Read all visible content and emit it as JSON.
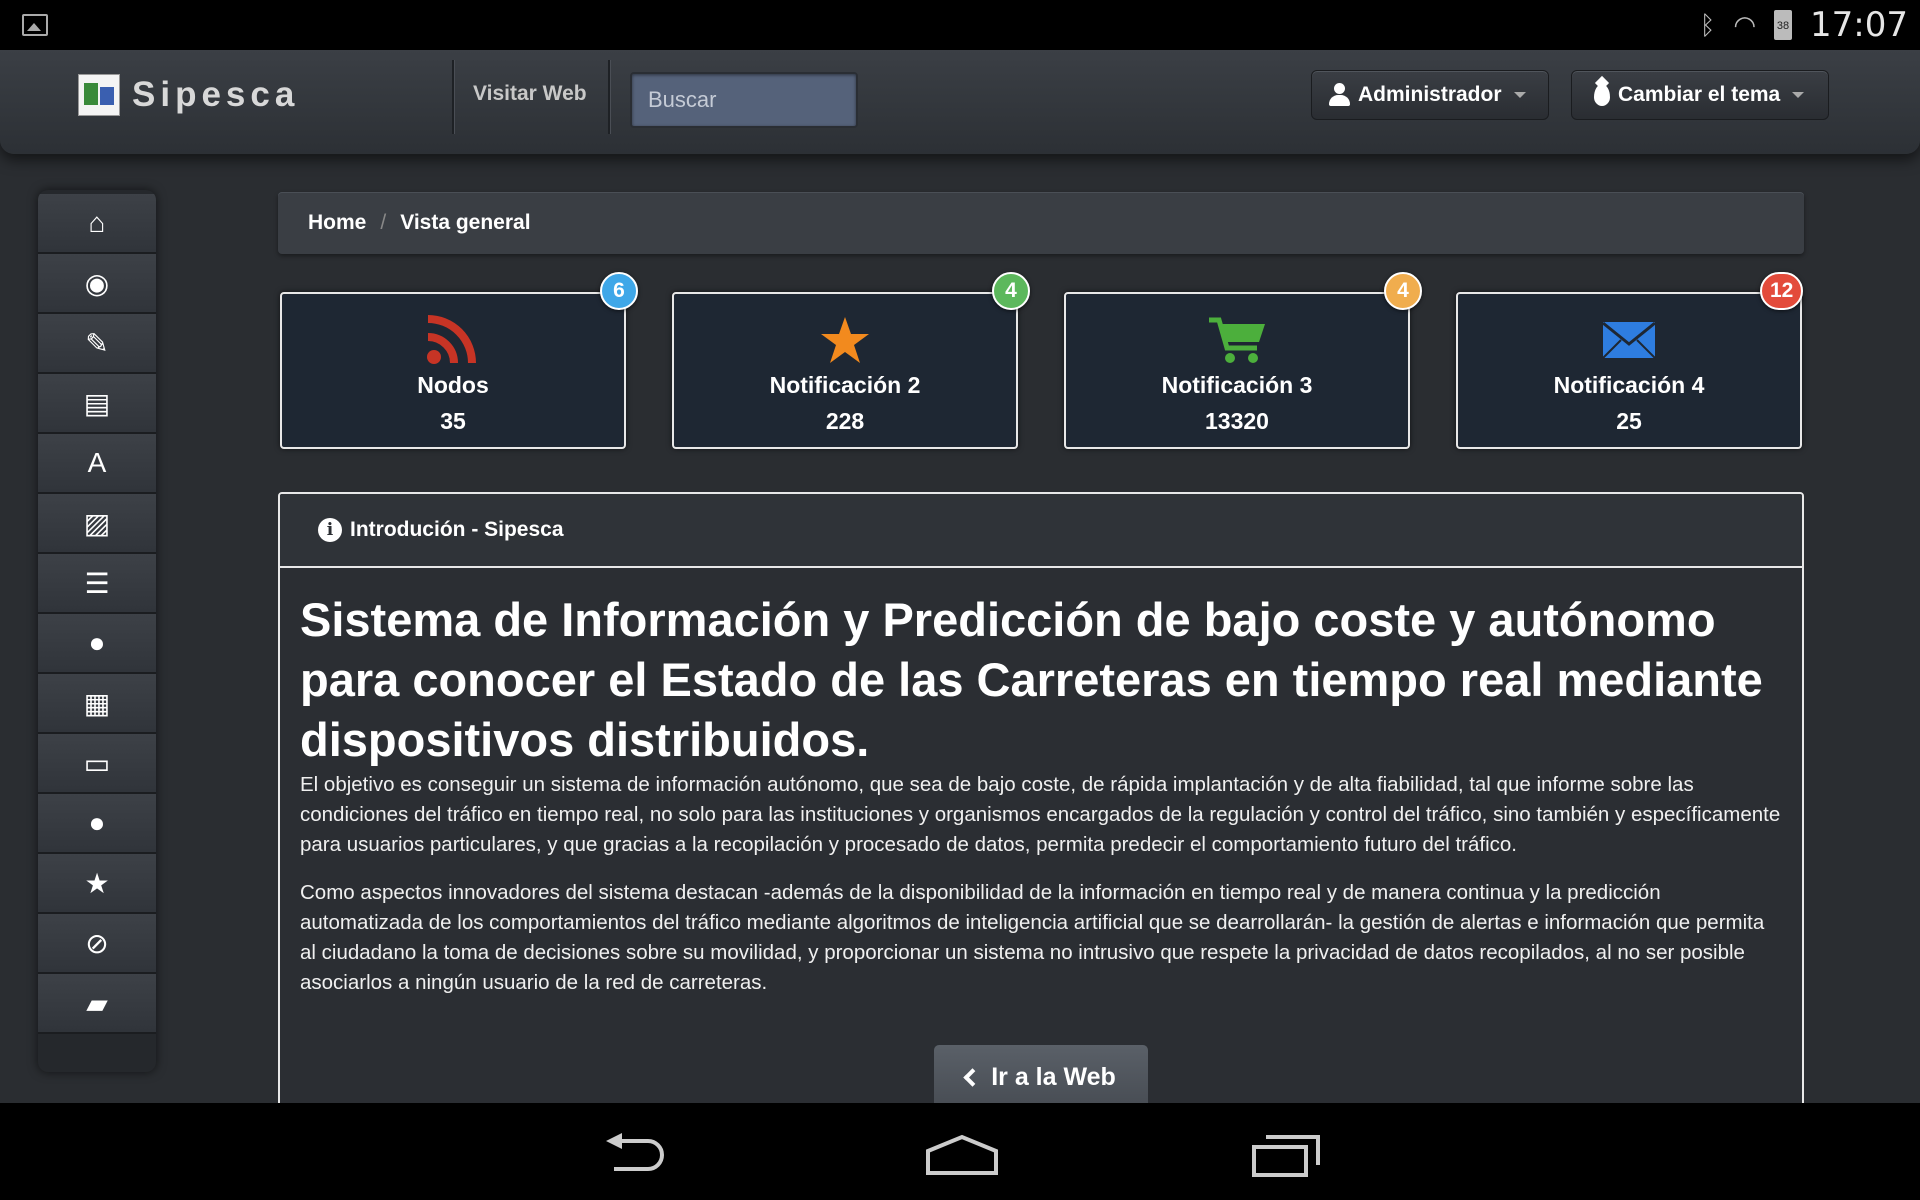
{
  "status_bar": {
    "time": "17:07",
    "battery": "38"
  },
  "navbar": {
    "brand": "Sipesca",
    "visit_web": "Visitar Web",
    "search_placeholder": "Buscar",
    "user_button": "Administrador",
    "theme_button": "Cambiar el tema"
  },
  "sidebar": {
    "items": [
      {
        "icon": "home-icon",
        "glyph": "⌂"
      },
      {
        "icon": "eye-icon",
        "glyph": "◉"
      },
      {
        "icon": "edit-icon",
        "glyph": "✎"
      },
      {
        "icon": "list-alt-icon",
        "glyph": "▤"
      },
      {
        "icon": "font-icon",
        "glyph": "A"
      },
      {
        "icon": "picture-icon",
        "glyph": "▨"
      },
      {
        "icon": "align-justify-icon",
        "glyph": "☰"
      },
      {
        "icon": "globe-icon",
        "glyph": "●"
      },
      {
        "icon": "th-icon",
        "glyph": "▦"
      },
      {
        "icon": "folder-open-icon",
        "glyph": "▭"
      },
      {
        "icon": "globe-icon",
        "glyph": "●"
      },
      {
        "icon": "star-icon",
        "glyph": "★"
      },
      {
        "icon": "ban-icon",
        "glyph": "⊘"
      },
      {
        "icon": "lock-icon",
        "glyph": "▰"
      }
    ]
  },
  "breadcrumb": {
    "home": "Home",
    "separator": "/",
    "current": "Vista general"
  },
  "stats": [
    {
      "icon": "rss-icon",
      "title": "Nodos",
      "value": "35",
      "badge": "6",
      "badge_color": "#3fa7e8"
    },
    {
      "icon": "star-icon",
      "title": "Notificación 2",
      "value": "228",
      "badge": "4",
      "badge_color": "#5cb85c"
    },
    {
      "icon": "shopping-cart-icon",
      "title": "Notificación 3",
      "value": "13320",
      "badge": "4",
      "badge_color": "#f0ad4e"
    },
    {
      "icon": "envelope-icon",
      "title": "Notificación 4",
      "value": "25",
      "badge": "12",
      "badge_color": "#e34b3b"
    }
  ],
  "panel": {
    "header": "Introdución - Sipesca",
    "heading": "Sistema de Información y Predicción de bajo coste y autónomo para conocer el Estado de las Carreteras en tiempo real mediante dispositivos distribuidos.",
    "paragraph1": "El objetivo es conseguir un sistema de información autónomo, que sea de bajo coste, de rápida implantación y de alta fiabilidad, tal que informe sobre las condiciones del tráfico en tiempo real, no solo para las instituciones y organismos encargados de la regulación y control del tráfico, sino también y específicamente para usuarios particulares, y que gracias a la recopilación y procesado de datos, permita predecir el comportamiento futuro del tráfico.",
    "paragraph2": "Como aspectos innovadores del sistema destacan -además de la disponibilidad de la información en tiempo real y de manera continua y la predicción automatizada de los comportamientos del tráfico mediante algoritmos de inteligencia artificial que se dearrollarán- la gestión de alertas e información que permita al ciudadano la toma de decisiones sobre su movilidad, y proporcionar un sistema no intrusivo que respete la privacidad de datos recopilados, al no ser posible asociarlos a ningún usuario de la red de carreteras.",
    "button": "Ir a la Web"
  },
  "colors": {
    "rss": "#c73425",
    "star": "#f28a1e",
    "cart": "#4caf3c",
    "envelope": "#2e7de0"
  }
}
